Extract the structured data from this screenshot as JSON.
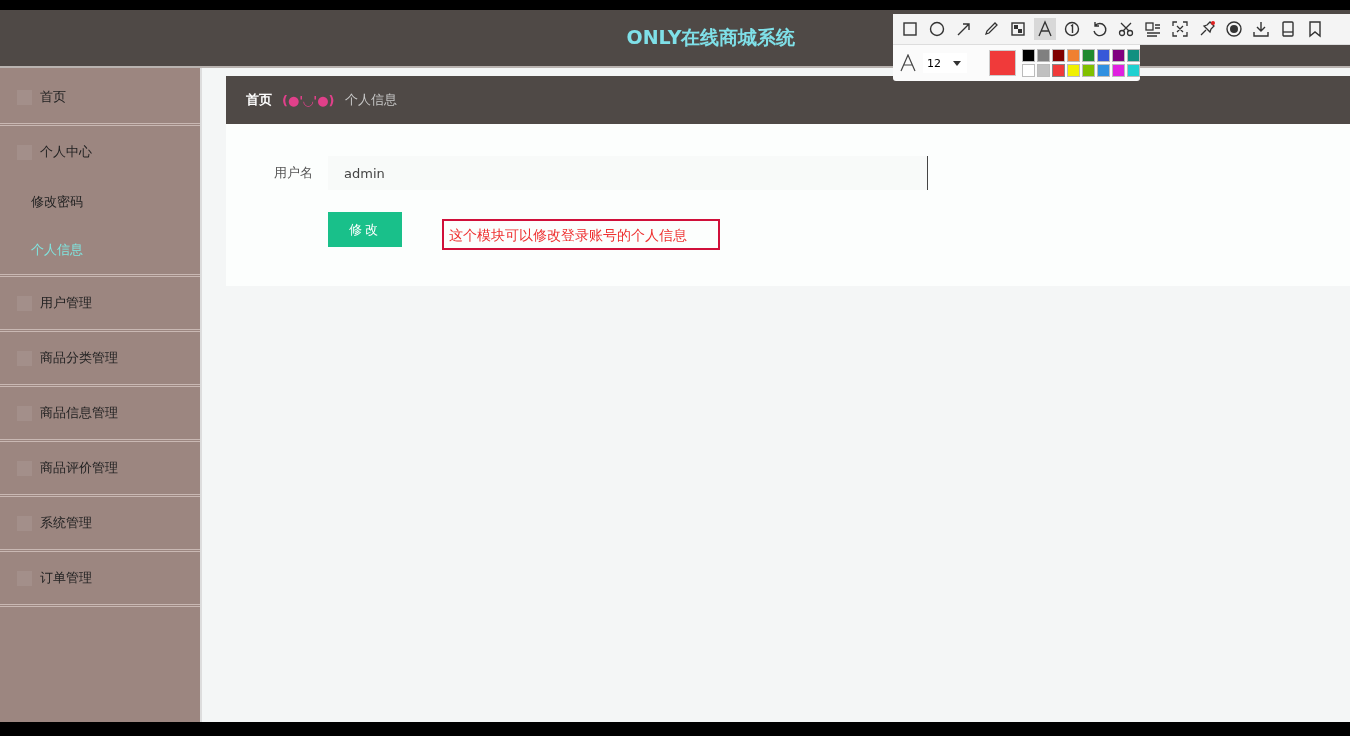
{
  "header": {
    "title": "ONLY在线商城系统"
  },
  "sidebar": {
    "items": [
      {
        "label": "首页",
        "selected": false
      },
      {
        "label": "个人中心",
        "selected": false,
        "expanded": true,
        "children": [
          {
            "label": "修改密码",
            "selected": false
          },
          {
            "label": "个人信息",
            "selected": true
          }
        ]
      },
      {
        "label": "用户管理",
        "selected": false
      },
      {
        "label": "商品分类管理",
        "selected": false
      },
      {
        "label": "商品信息管理",
        "selected": false
      },
      {
        "label": "商品评价管理",
        "selected": false
      },
      {
        "label": "系统管理",
        "selected": false
      },
      {
        "label": "订单管理",
        "selected": false
      }
    ]
  },
  "breadcrumb": [
    {
      "kind": "link",
      "text": "首页"
    },
    {
      "kind": "separator",
      "text": "(●'◡'●)"
    },
    {
      "kind": "current",
      "text": "个人信息"
    }
  ],
  "form": {
    "fields": [
      {
        "label": "用户名",
        "value": "admin"
      }
    ],
    "button": "修改"
  },
  "annotation": {
    "text": "这个模块可以修改登录账号的个人信息"
  },
  "capture_toolbar": {
    "tools": [
      {
        "kind": "rectangle",
        "selected": false
      },
      {
        "kind": "ellipse",
        "selected": false
      },
      {
        "kind": "arrow",
        "selected": false
      },
      {
        "kind": "pencil",
        "selected": false
      },
      {
        "kind": "mosaic",
        "selected": false
      },
      {
        "kind": "text",
        "selected": true
      },
      {
        "kind": "number",
        "selected": false
      },
      {
        "kind": "undo",
        "selected": false
      },
      {
        "kind": "cut",
        "selected": false
      },
      {
        "kind": "ocr",
        "selected": false
      },
      {
        "kind": "scan",
        "selected": false
      },
      {
        "kind": "pin",
        "selected": false
      },
      {
        "kind": "record",
        "selected": false
      },
      {
        "kind": "download",
        "selected": false
      },
      {
        "kind": "tablet",
        "selected": false
      },
      {
        "kind": "bookmark",
        "selected": false
      }
    ],
    "font_size": "12",
    "swatches": [
      {
        "color": "#000000",
        "selected": false
      },
      {
        "color": "#808080",
        "selected": false
      },
      {
        "color": "#800000",
        "selected": false
      },
      {
        "color": "#f08030",
        "selected": false
      },
      {
        "color": "#208a30",
        "selected": false
      },
      {
        "color": "#3858d8",
        "selected": false
      },
      {
        "color": "#800080",
        "selected": false
      },
      {
        "color": "#109080",
        "selected": false
      },
      {
        "color": "#ffffff",
        "selected": false
      },
      {
        "color": "#c0c0c0",
        "selected": false
      },
      {
        "color": "#f03a3a",
        "selected": true
      },
      {
        "color": "#f0f000",
        "selected": false
      },
      {
        "color": "#80c000",
        "selected": false
      },
      {
        "color": "#3090e0",
        "selected": false
      },
      {
        "color": "#e020e0",
        "selected": false
      },
      {
        "color": "#20d0d0",
        "selected": false
      }
    ]
  }
}
